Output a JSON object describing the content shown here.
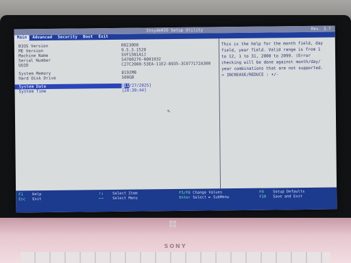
{
  "title": "InsydeH2O Setup Utility",
  "revision": "Rev. 3.7",
  "menu": [
    "Main",
    "Advanced",
    "Security",
    "Boot",
    "Exit"
  ],
  "info_rows": [
    {
      "label": "BIOS Version",
      "value": "R0230D0"
    },
    {
      "label": "ME Version",
      "value": "9.5.3.1520"
    },
    {
      "label": "Machine Name",
      "value": "SVF15N1A1J"
    },
    {
      "label": "Serial Number",
      "value": "54700276-0001932"
    },
    {
      "label": "UUID",
      "value": "C27C2000-53EA-11E2-8935-3C077172A300"
    }
  ],
  "memory_rows": [
    {
      "label": "System Memory",
      "value": "8192MB"
    },
    {
      "label": "Hard Disk Drive",
      "value": "500GB"
    }
  ],
  "system_date": {
    "label": "System Date",
    "value_prefix": "[",
    "value_highlight": "11",
    "value_rest": "/27/2025]"
  },
  "system_time": {
    "label": "System Time",
    "value": "[20:30:44]"
  },
  "help_text": "This is the help for the month field, day\nfield, year field. Valid range is from 1\nto 12, 1 to 31, 2000 to 2099. (Error\nchecking will be done against month/day/\nyear combinations that are not supported.\n> INCREASE/REDUCE : +/-",
  "footer_row1": [
    {
      "key": "F1",
      "desc": "Help"
    },
    {
      "key": "↑↓",
      "desc": "Select Item"
    },
    {
      "key": "F5/F6",
      "desc": "Change Values"
    },
    {
      "key": "F9",
      "desc": "Setup Defaults"
    }
  ],
  "footer_row2": [
    {
      "key": "Esc",
      "desc": "Exit"
    },
    {
      "key": "←→",
      "desc": "Select Menu"
    },
    {
      "key": "Enter",
      "desc": "Select ► SubMenu"
    },
    {
      "key": "F10",
      "desc": "Save and Exit"
    }
  ],
  "brand": "SONY",
  "colors": {
    "title_bar": "#7a84a8",
    "menu_bar": "#1f3d9c",
    "screen_bg": "#d9dcdd",
    "footer": "#1c3a8e",
    "key_color": "#7fe3c0"
  }
}
